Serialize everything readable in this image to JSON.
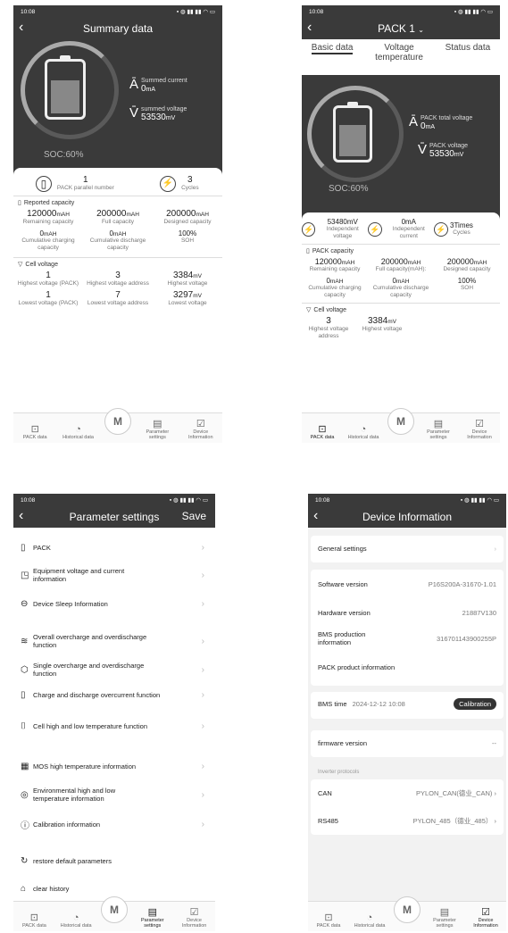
{
  "status_time": "10:08",
  "s1": {
    "title": "Summary data",
    "soc": "SOC:60%",
    "summed_current_label": "Summed current",
    "summed_current": "0",
    "current_unit": "mA",
    "summed_voltage_label": "summed voltage",
    "summed_voltage": "53530",
    "voltage_unit": "mV",
    "pack_count": "1",
    "pack_count_label": "PACK parallel number",
    "cycles": "3",
    "cycles_label": "Cycles",
    "reported_capacity": "Reported capacity",
    "cap": [
      {
        "v": "120000",
        "u": "mAH",
        "l": "Remaining capacity"
      },
      {
        "v": "200000",
        "u": "mAH",
        "l": "Full capacity"
      },
      {
        "v": "200000",
        "u": "mAH",
        "l": "Designed capacity"
      },
      {
        "v": "0",
        "u": "mAH",
        "l": "Cumulative charging capacity"
      },
      {
        "v": "0",
        "u": "mAH",
        "l": "Cumulative discharge capacity"
      },
      {
        "v": "100%",
        "u": "",
        "l": "SOH"
      }
    ],
    "cell_voltage": "Cell voltage",
    "cv": [
      {
        "v": "1",
        "u": "",
        "l": "Highest voltage (PACK)"
      },
      {
        "v": "3",
        "u": "",
        "l": "Highest voltage address"
      },
      {
        "v": "3384",
        "u": "mV",
        "l": "Highest voltage"
      },
      {
        "v": "1",
        "u": "",
        "l": "Lowest voltage (PACK)"
      },
      {
        "v": "7",
        "u": "",
        "l": "Lowest voltage address"
      },
      {
        "v": "3297",
        "u": "mV",
        "l": "Lowest voltage"
      }
    ]
  },
  "tabs": {
    "pack": "PACK data",
    "hist": "Historical data",
    "logo": "M",
    "param": "Parameter settings",
    "device": "Device Information"
  },
  "s2": {
    "title": "PACK 1",
    "tab_basic": "Basic data",
    "tab_voltage": "Voltage temperature",
    "tab_status": "Status data",
    "soc": "SOC:60%",
    "total_voltage_label": "PACK total voltage",
    "total_current": "0",
    "current_unit": "mA",
    "pack_voltage_label": "PACK voltage",
    "pack_voltage": "53530",
    "voltage_unit": "mV",
    "ind_voltage": "53480mV",
    "ind_voltage_label": "Independent voltage",
    "ind_current": "0mA",
    "ind_current_label": "Independent current",
    "cycles": "3Times",
    "cycles_label": "Cycles",
    "pack_capacity": "PACK capacity",
    "cap": [
      {
        "v": "120000",
        "u": "mAH",
        "l": "Remaining capacity"
      },
      {
        "v": "200000",
        "u": "mAH",
        "l": "Full capacity(mAH):"
      },
      {
        "v": "200000",
        "u": "mAH",
        "l": "Designed capacity"
      },
      {
        "v": "0",
        "u": "mAH",
        "l": "Cumulative charging capacity"
      },
      {
        "v": "0",
        "u": "mAH",
        "l": "Cumulative discharge capacity"
      },
      {
        "v": "100%",
        "u": "",
        "l": "SOH"
      }
    ],
    "cell_voltage": "Cell voltage",
    "cv": [
      {
        "v": "3",
        "u": "",
        "l": "Highest voltage address"
      },
      {
        "v": "3384",
        "u": "mV",
        "l": "Highest voltage"
      }
    ]
  },
  "s3": {
    "title": "Parameter settings",
    "save": "Save",
    "items": [
      {
        "icon": "▯",
        "label": "PACK"
      },
      {
        "icon": "◳",
        "label": "Equipment voltage and current information"
      },
      {
        "icon": "⊖",
        "label": "Device Sleep Information"
      },
      {
        "icon": "≋",
        "label": "Overall overcharge and overdischarge function"
      },
      {
        "icon": "⬡",
        "label": "Single overcharge and overdischarge function"
      },
      {
        "icon": "▯",
        "label": "Charge and discharge overcurrent function"
      },
      {
        "icon": "⌷",
        "label": "Cell high and low temperature function"
      },
      {
        "icon": "▦",
        "label": "MOS high temperature information"
      },
      {
        "icon": "◎",
        "label": "Environmental high and low temperature information"
      },
      {
        "icon": "ⓘ",
        "label": "Calibration information"
      },
      {
        "icon": "↻",
        "label": "restore default parameters"
      },
      {
        "icon": "⌂",
        "label": "clear history"
      }
    ]
  },
  "s4": {
    "title": "Device Information",
    "general": "General settings",
    "sw_label": "Software version",
    "sw": "P16S200A-31670-1.01",
    "hw_label": "Hardware version",
    "hw": "21887V130",
    "bms_prod_label": "BMS production information",
    "bms_prod": "316701143900255P",
    "pack_prod_label": "PACK product information",
    "bms_time_label": "BMS time",
    "bms_time": "2024-12-12 10:08",
    "calibration": "Calibration",
    "fw_label": "firmware version",
    "fw": "--",
    "inverter": "Inverter protocols",
    "can_label": "CAN",
    "can": "PYLON_CAN(德业_CAN)",
    "rs_label": "RS485",
    "rs": "PYLON_485（德业_485）"
  }
}
